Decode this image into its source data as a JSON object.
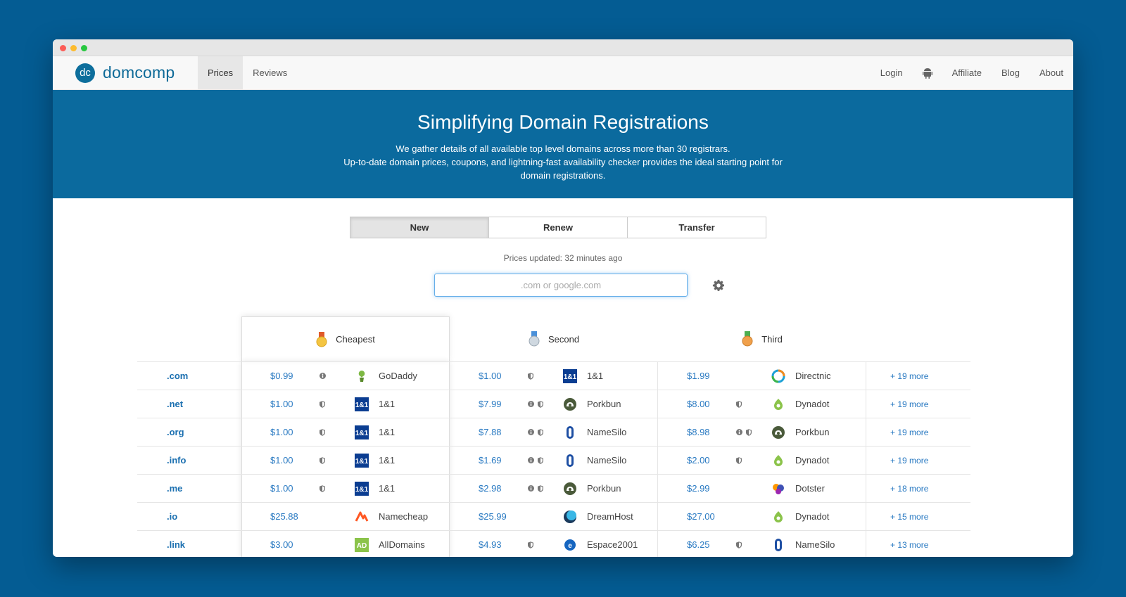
{
  "brand": {
    "logo_text": "dc",
    "name": "domcomp"
  },
  "nav": {
    "left": [
      {
        "label": "Prices",
        "active": true
      },
      {
        "label": "Reviews",
        "active": false
      }
    ],
    "right": {
      "login": "Login",
      "affiliate": "Affiliate",
      "blog": "Blog",
      "about": "About"
    }
  },
  "hero": {
    "title": "Simplifying Domain Registrations",
    "line1": "We gather details of all available top level domains across more than 30 registrars.",
    "line2": "Up-to-date domain prices, coupons, and lightning-fast availability checker provides the ideal starting point for",
    "line3": "domain registrations."
  },
  "modes": {
    "new": "New",
    "renew": "Renew",
    "transfer": "Transfer",
    "active": "New"
  },
  "updated": "Prices updated: 32 minutes ago",
  "search": {
    "placeholder": ".com or google.com"
  },
  "columns": {
    "cheapest": "Cheapest",
    "second": "Second",
    "third": "Third"
  },
  "colors": {
    "link": "#2a7ac2",
    "hero": "#0b6a9e",
    "background": "#045c93"
  },
  "rows": [
    {
      "tld": ".com",
      "more": "+ 19 more",
      "c": [
        {
          "price": "$0.99",
          "icons": [
            "info"
          ],
          "registrar": "GoDaddy",
          "logo": "godaddy"
        },
        {
          "price": "$1.00",
          "icons": [
            "shield"
          ],
          "registrar": "1&1",
          "logo": "oneandone"
        },
        {
          "price": "$1.99",
          "icons": [],
          "registrar": "Directnic",
          "logo": "directnic"
        }
      ]
    },
    {
      "tld": ".net",
      "more": "+ 19 more",
      "c": [
        {
          "price": "$1.00",
          "icons": [
            "shield"
          ],
          "registrar": "1&1",
          "logo": "oneandone"
        },
        {
          "price": "$7.99",
          "icons": [
            "info",
            "shield"
          ],
          "registrar": "Porkbun",
          "logo": "porkbun"
        },
        {
          "price": "$8.00",
          "icons": [
            "shield"
          ],
          "registrar": "Dynadot",
          "logo": "dynadot"
        }
      ]
    },
    {
      "tld": ".org",
      "more": "+ 19 more",
      "c": [
        {
          "price": "$1.00",
          "icons": [
            "shield"
          ],
          "registrar": "1&1",
          "logo": "oneandone"
        },
        {
          "price": "$7.88",
          "icons": [
            "info",
            "shield"
          ],
          "registrar": "NameSilo",
          "logo": "namesilo"
        },
        {
          "price": "$8.98",
          "icons": [
            "info",
            "shield"
          ],
          "registrar": "Porkbun",
          "logo": "porkbun"
        }
      ]
    },
    {
      "tld": ".info",
      "more": "+ 19 more",
      "c": [
        {
          "price": "$1.00",
          "icons": [
            "shield"
          ],
          "registrar": "1&1",
          "logo": "oneandone"
        },
        {
          "price": "$1.69",
          "icons": [
            "info",
            "shield"
          ],
          "registrar": "NameSilo",
          "logo": "namesilo"
        },
        {
          "price": "$2.00",
          "icons": [
            "shield"
          ],
          "registrar": "Dynadot",
          "logo": "dynadot"
        }
      ]
    },
    {
      "tld": ".me",
      "more": "+ 18 more",
      "c": [
        {
          "price": "$1.00",
          "icons": [
            "shield"
          ],
          "registrar": "1&1",
          "logo": "oneandone"
        },
        {
          "price": "$2.98",
          "icons": [
            "info",
            "shield"
          ],
          "registrar": "Porkbun",
          "logo": "porkbun"
        },
        {
          "price": "$2.99",
          "icons": [],
          "registrar": "Dotster",
          "logo": "dotster"
        }
      ]
    },
    {
      "tld": ".io",
      "more": "+ 15 more",
      "c": [
        {
          "price": "$25.88",
          "icons": [],
          "registrar": "Namecheap",
          "logo": "namecheap"
        },
        {
          "price": "$25.99",
          "icons": [],
          "registrar": "DreamHost",
          "logo": "dreamhost"
        },
        {
          "price": "$27.00",
          "icons": [],
          "registrar": "Dynadot",
          "logo": "dynadot"
        }
      ]
    },
    {
      "tld": ".link",
      "more": "+ 13 more",
      "c": [
        {
          "price": "$3.00",
          "icons": [],
          "registrar": "AllDomains",
          "logo": "alldomains"
        },
        {
          "price": "$4.93",
          "icons": [
            "shield"
          ],
          "registrar": "Espace2001",
          "logo": "espace2001"
        },
        {
          "price": "$6.25",
          "icons": [
            "shield"
          ],
          "registrar": "NameSilo",
          "logo": "namesilo"
        }
      ]
    }
  ]
}
